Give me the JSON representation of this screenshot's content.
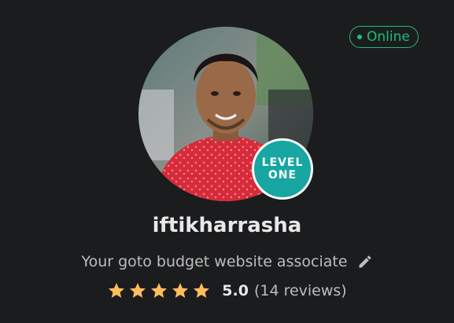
{
  "status": {
    "label": "Online",
    "color": "#1dbf73"
  },
  "profile": {
    "username": "iftikharrasha",
    "tagline": "Your goto budget website associate",
    "level_line1": "LEVEL",
    "level_line2": "ONE"
  },
  "rating": {
    "stars": 5,
    "score": "5.0",
    "reviews": "(14 reviews)"
  },
  "icons": {
    "edit": "pencil-icon",
    "star": "star-icon",
    "status": "online-dot-icon"
  },
  "colors": {
    "background": "#1b1c1e",
    "accent": "#1dbf73",
    "level_badge": "#17a6a2",
    "star": "#ffbe5b"
  }
}
